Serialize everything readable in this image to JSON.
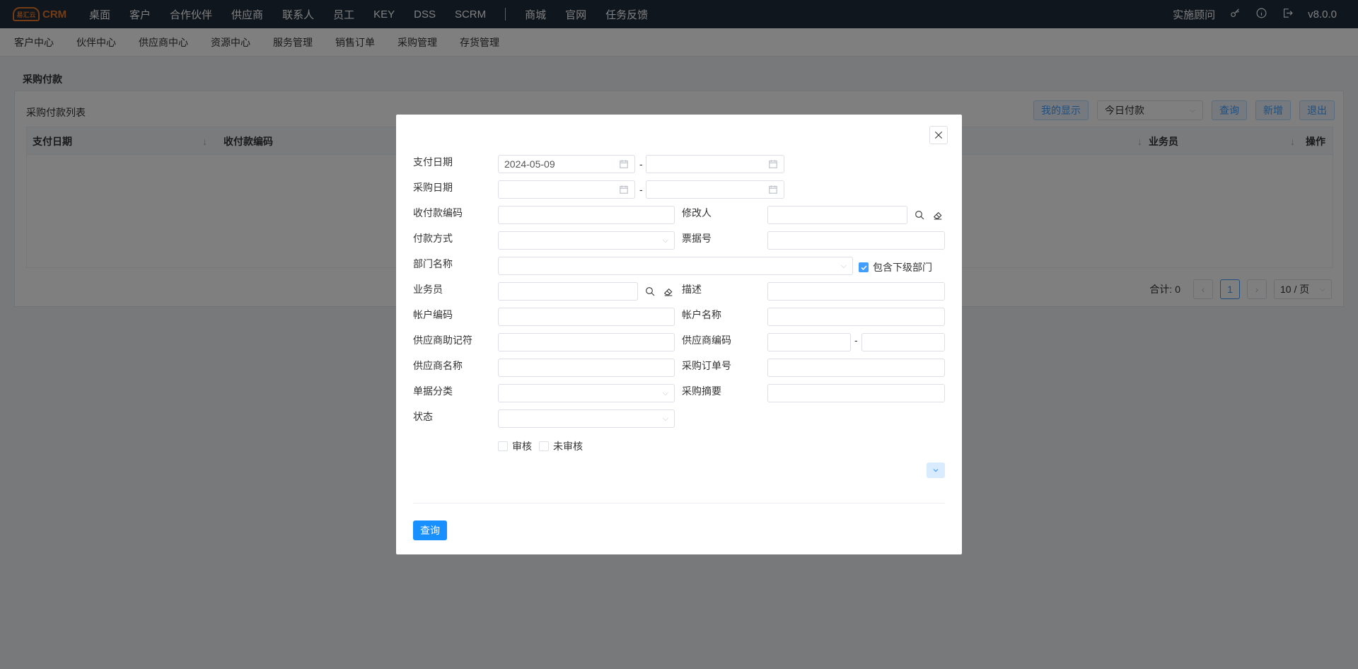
{
  "app": {
    "logo_small": "易汇云",
    "logo_text": "CRM"
  },
  "topnav": {
    "items": [
      "桌面",
      "客户",
      "合作伙伴",
      "供应商",
      "联系人",
      "员工",
      "KEY",
      "DSS",
      "SCRM"
    ],
    "items2": [
      "商城",
      "官网",
      "任务反馈"
    ],
    "consultant": "实施顾问",
    "version": "v8.0.0"
  },
  "subnav": {
    "items": [
      "客户中心",
      "伙伴中心",
      "供应商中心",
      "资源中心",
      "服务管理",
      "销售订单",
      "采购管理",
      "存货管理"
    ]
  },
  "page": {
    "title": "采购付款",
    "list_title": "采购付款列表",
    "toolbar": {
      "my_display": "我的显示",
      "filter_value": "今日付款",
      "query": "查询",
      "add": "新增",
      "exit": "退出"
    },
    "columns": [
      "支付日期",
      "收付款编码",
      "业务员",
      "操作"
    ],
    "pager": {
      "total_label": "合计:",
      "total": "0",
      "current_page": "1",
      "page_size": "10 / 页"
    }
  },
  "modal": {
    "fields": {
      "pay_date": "支付日期",
      "pay_date_from": "2024-05-09",
      "purchase_date": "采购日期",
      "code": "收付款编码",
      "modifier": "修改人",
      "pay_method": "付款方式",
      "bill_no": "票据号",
      "dept": "部门名称",
      "include_sub": "包含下级部门",
      "salesman": "业务员",
      "desc": "描述",
      "acct_code": "帐户编码",
      "acct_name": "帐户名称",
      "supplier_mnemonic": "供应商助记符",
      "supplier_code": "供应商编码",
      "supplier_name": "供应商名称",
      "po_no": "采购订单号",
      "bill_category": "单据分类",
      "purchase_summary": "采购摘要",
      "status": "状态",
      "audited": "审核",
      "unaudited": "未审核"
    },
    "dash": "-",
    "query_button": "查询"
  }
}
